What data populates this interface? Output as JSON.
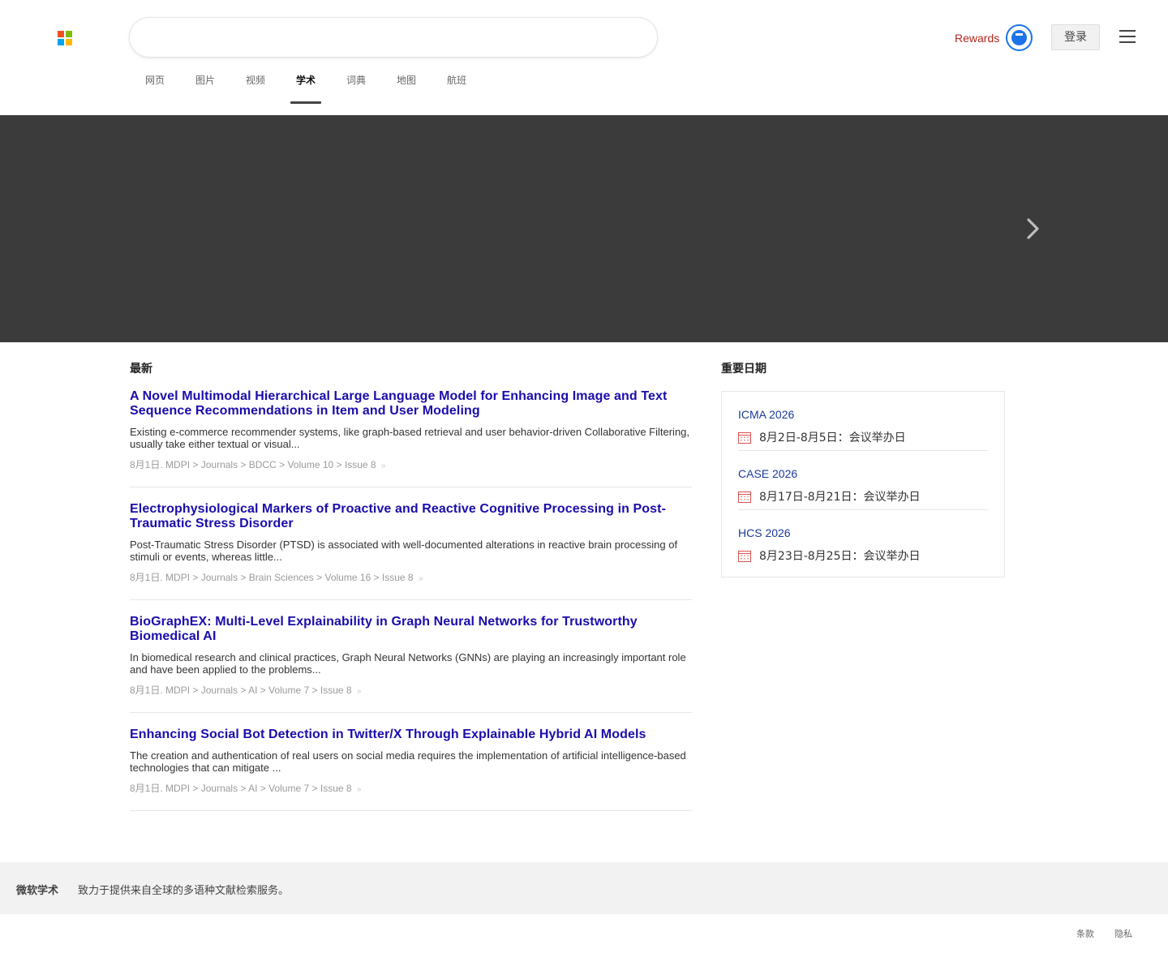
{
  "header": {
    "search_value": "",
    "tabs": [
      "网页",
      "图片",
      "视频",
      "学术",
      "词典",
      "地图",
      "航班"
    ],
    "active_tab": "学术",
    "rewards_label": "Rewards",
    "login_label": "登录",
    "logo_colors": [
      "#f25022",
      "#7fba00",
      "#00a4ef",
      "#ffb900"
    ]
  },
  "banner": {
    "background": "#3b3b3b",
    "next_icon": "chevron-right-icon"
  },
  "latest": {
    "title": "最新",
    "articles": [
      {
        "title": "A Novel Multimodal Hierarchical Large Language Model for Enhancing Image and Text Sequence Recommendations in Item and User Modeling",
        "snippet": "Existing e-commerce recommender systems, like graph-based retrieval and user behavior-driven Collaborative Filtering, usually take either textual or visual...",
        "date": "8月1日.",
        "path": [
          "MDPI",
          "Journals",
          "BDCC",
          "Volume 10",
          "Issue 8"
        ]
      },
      {
        "title": "Electrophysiological Markers of Proactive and Reactive Cognitive Processing in Post-Traumatic Stress Disorder",
        "snippet": "Post-Traumatic Stress Disorder (PTSD) is associated with well-documented alterations in reactive brain processing of stimuli or events, whereas little...",
        "date": "8月1日.",
        "path": [
          "MDPI",
          "Journals",
          "Brain Sciences",
          "Volume 16",
          "Issue 8"
        ]
      },
      {
        "title": "BioGraphEX: Multi-Level Explainability in Graph Neural Networks for Trustworthy Biomedical AI",
        "snippet": "In biomedical research and clinical practices, Graph Neural Networks (GNNs) are playing an increasingly important role and have been applied to the problems...",
        "date": "8月1日.",
        "path": [
          "MDPI",
          "Journals",
          "AI",
          "Volume 7",
          "Issue 8"
        ]
      },
      {
        "title": "Enhancing Social Bot Detection in Twitter/X Through Explainable Hybrid AI Models",
        "snippet": "The creation and authentication of real users on social media requires the implementation of artificial intelligence-based technologies that can mitigate ...",
        "date": "8月1日.",
        "path": [
          "MDPI",
          "Journals",
          "AI",
          "Volume 7",
          "Issue 8"
        ]
      }
    ]
  },
  "important_dates": {
    "title": "重要日期",
    "items": [
      {
        "name": "ICMA 2026",
        "date": "8月2日-8月5日：会议举办日"
      },
      {
        "name": "CASE 2026",
        "date": "8月17日-8月21日：会议举办日"
      },
      {
        "name": "HCS 2026",
        "date": "8月23日-8月25日：会议举办日"
      }
    ]
  },
  "footer": {
    "brand": "微软学术",
    "description": "致力于提供来自全球的多语种文献检索服务。",
    "terms_label": "条款",
    "privacy_label": "隐私"
  },
  "colors": {
    "title_link": "#1a0dab",
    "rewards_red": "#b3261e",
    "medal_blue": "#1a73e8",
    "calendar_red": "#d9534f"
  }
}
